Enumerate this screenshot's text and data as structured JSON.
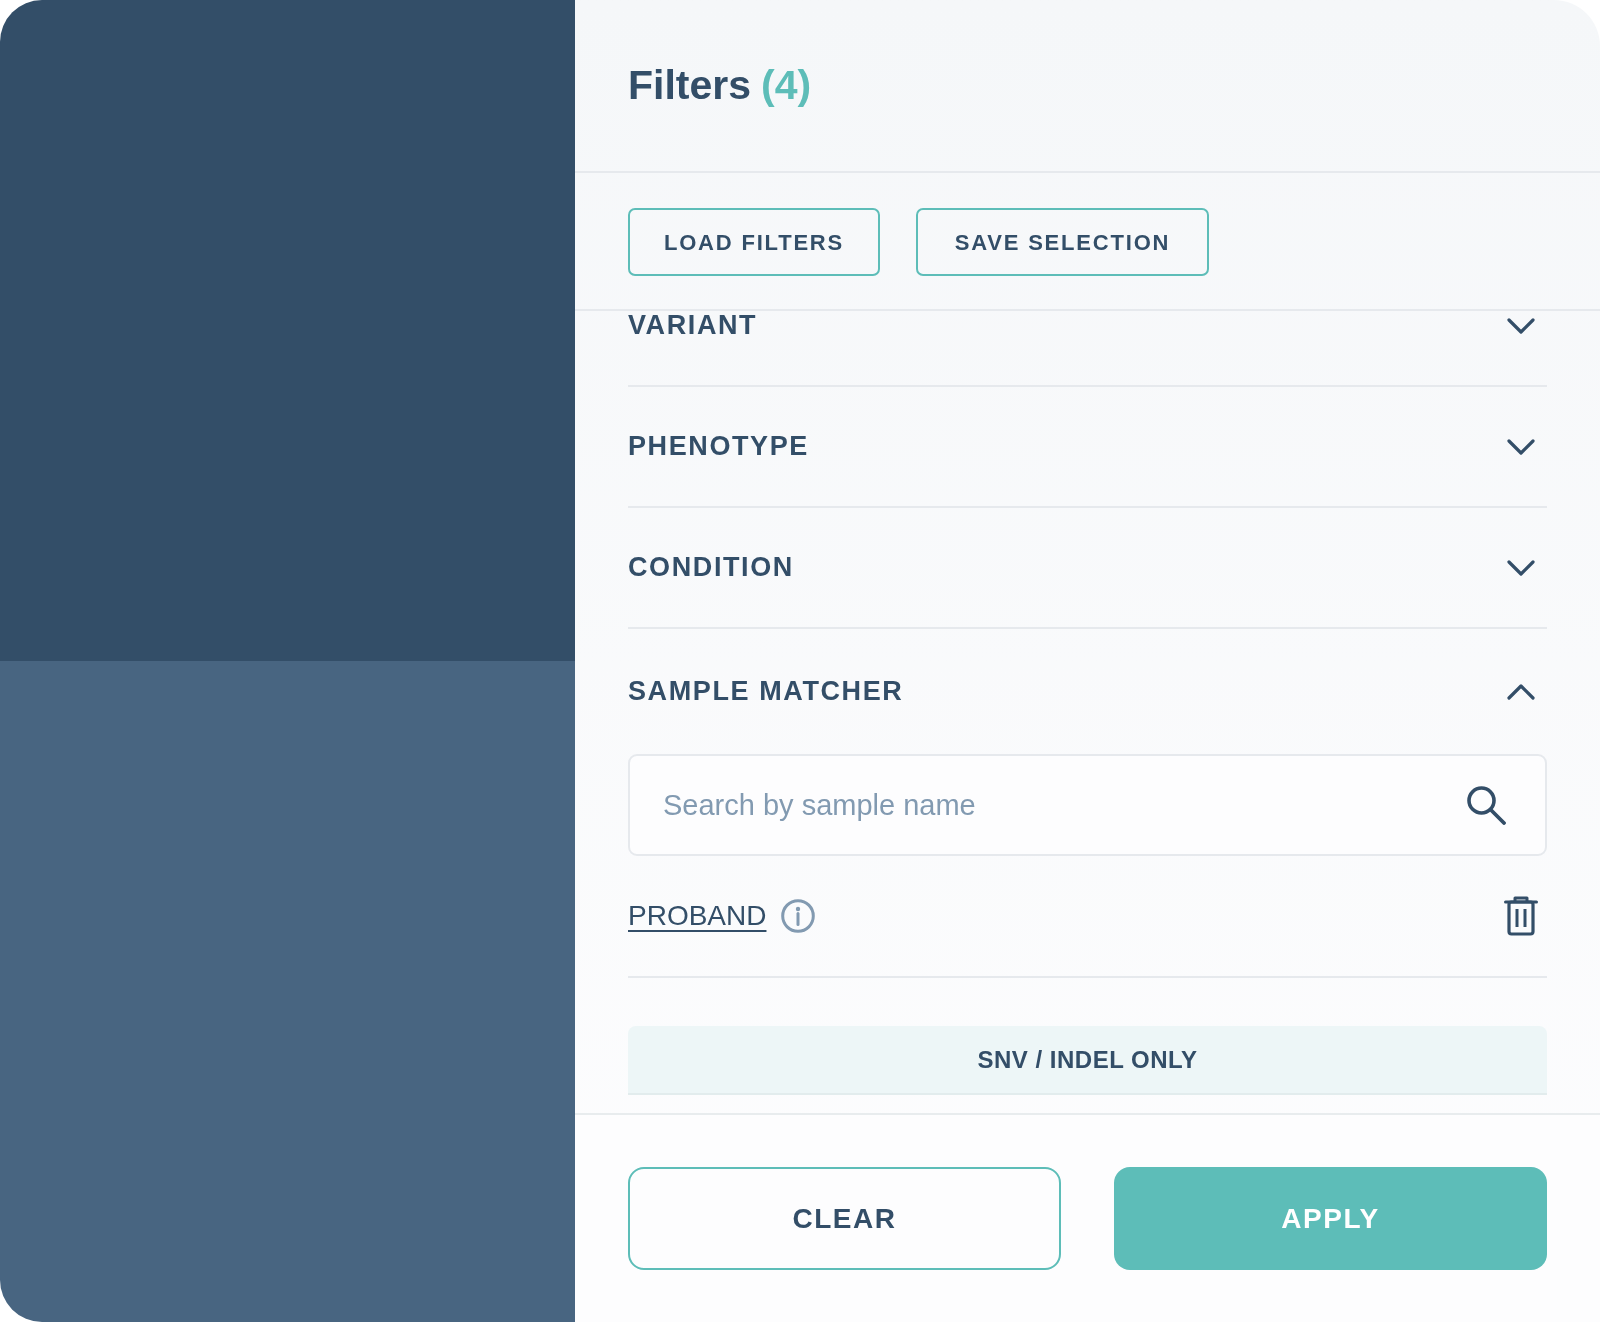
{
  "panel": {
    "title": "Filters",
    "count": "(4)"
  },
  "toolbar": {
    "buttons": [
      {
        "label": "LOAD FILTERS"
      },
      {
        "label": "SAVE SELECTION"
      }
    ]
  },
  "sections": [
    {
      "label": "VARIANT",
      "expanded": false
    },
    {
      "label": "PHENOTYPE",
      "expanded": false
    },
    {
      "label": "CONDITION",
      "expanded": false
    },
    {
      "label": "SAMPLE MATCHER",
      "expanded": true,
      "search": {
        "placeholder": "Search by sample name"
      },
      "samples": [
        {
          "label": "PROBAND"
        }
      ]
    }
  ],
  "variant_toggle": {
    "label": "SNV / INDEL ONLY"
  },
  "footer": {
    "buttons": [
      {
        "label": "CLEAR",
        "kind": "secondary"
      },
      {
        "label": "APPLY",
        "kind": "primary"
      }
    ]
  }
}
